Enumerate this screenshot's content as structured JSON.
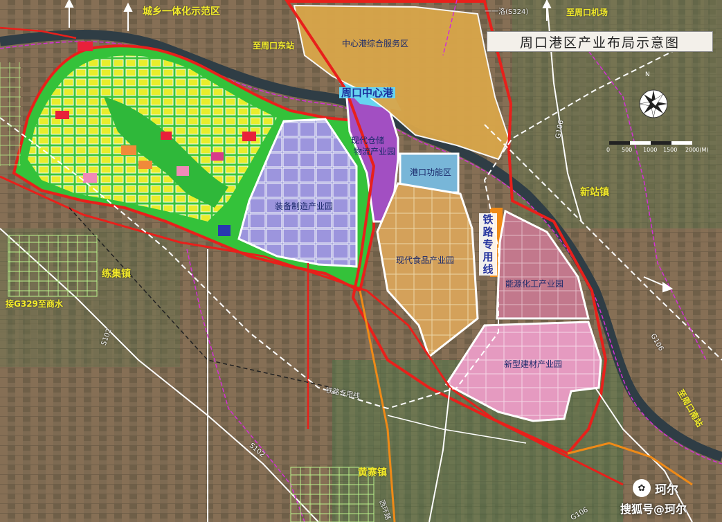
{
  "map": {
    "title": "周口港区产业布局示意图",
    "zones": {
      "service": "中心港综合服务区",
      "central_port": "周口中心港",
      "logistics_line1": "现代仓储",
      "logistics_line2": "物流产业园",
      "port_function": "港口功能区",
      "equipment": "装备制造产业园",
      "food": "现代食品产业园",
      "energy": "能源化工产业园",
      "building": "新型建材产业园"
    },
    "towns": {
      "lianji": "练集镇",
      "xinzhan": "新站镇",
      "huangzhai": "黄寨镇"
    },
    "labels": {
      "urban_rural": "城乡一体化示范区",
      "to_east_station": "至周口东站",
      "to_airport": "至周口机场",
      "to_shangshui": "接G329至商水",
      "to_zhoukou_south": "至周口南站",
      "rail_special_line": "铁路专用线",
      "railway_line": "铁路专用线"
    },
    "roads": {
      "s102_a": "S102",
      "s102_b": "S102",
      "g106_a": "G106",
      "g106_b": "G106",
      "g106_c": "G106",
      "sxx": "一一洛(S324)",
      "connector": "西环路"
    },
    "scale": {
      "ticks": [
        "0",
        "500",
        "1000",
        "1500",
        "2000(M)"
      ]
    },
    "compass": "N",
    "watermark": {
      "icon_glyph": "✿",
      "name": "珂尔",
      "site": "搜狐号@珂尔"
    },
    "colors": {
      "boundary": "#e8201b",
      "residential_yellow": "#f2ef2a",
      "green_space": "#3bc43c",
      "service_zone": "#d9a64a",
      "logistics_zone": "#a24fc2",
      "port_zone": "#78b6d8",
      "equipment_zone": "#8f8fd8",
      "food_zone": "#d7a35b",
      "energy_zone": "#c07a8c",
      "building_zone": "#e18fb5",
      "rail_line": "#ef8a17",
      "river": "#3d4a52"
    }
  }
}
